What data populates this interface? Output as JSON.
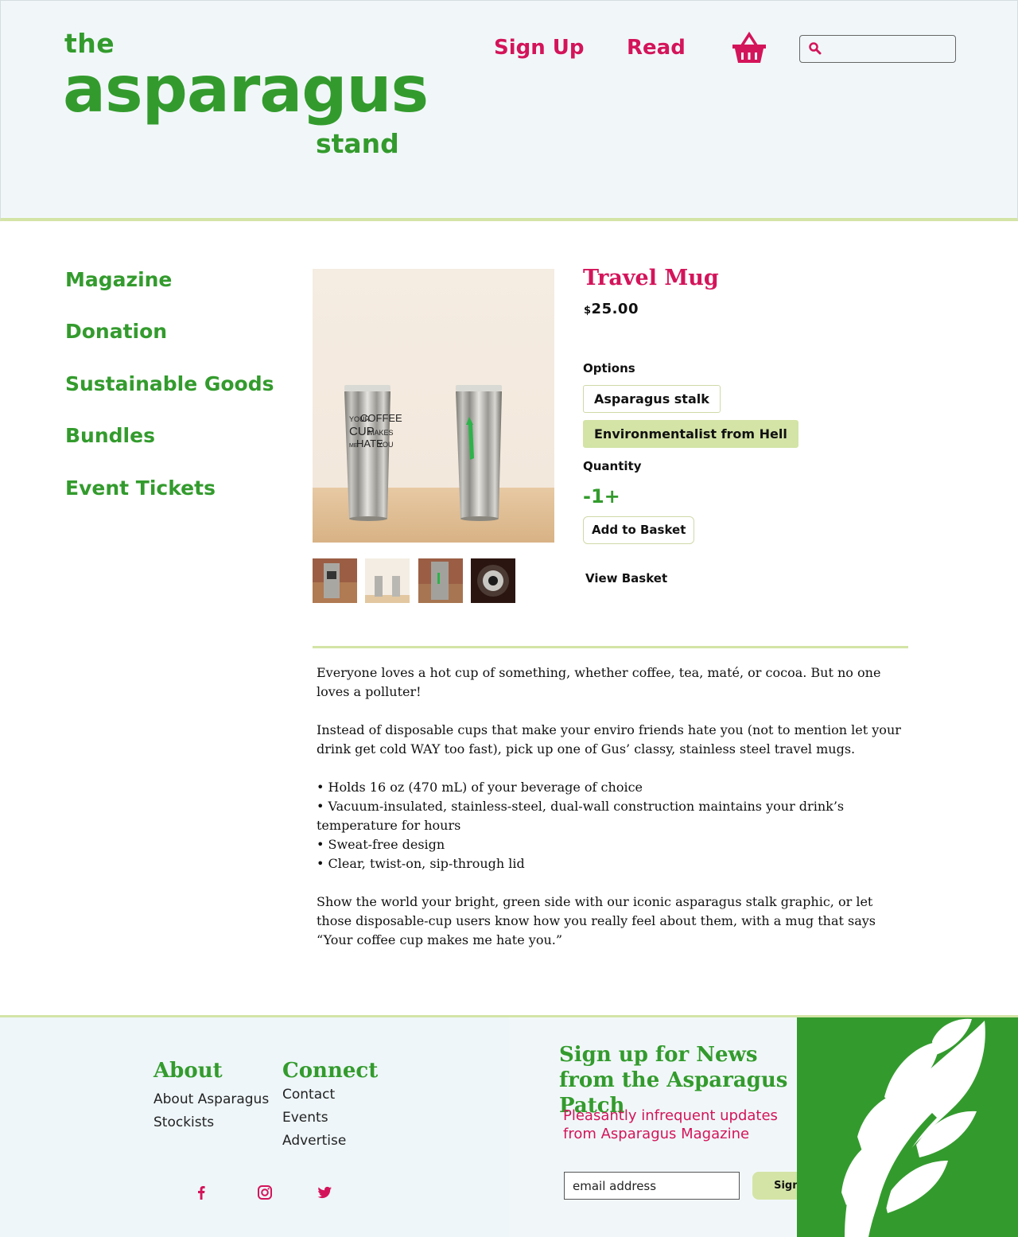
{
  "header": {
    "logo_the": "the",
    "logo_main": "asparagus",
    "logo_stand": "stand",
    "nav": [
      {
        "label": "Sign Up"
      },
      {
        "label": "Read"
      }
    ],
    "basket_icon": "basket-icon",
    "search": {
      "placeholder": "",
      "icon": "search-icon"
    }
  },
  "sidebar": {
    "items": [
      {
        "label": "Magazine"
      },
      {
        "label": "Donation"
      },
      {
        "label": "Sustainable Goods"
      },
      {
        "label": "Bundles"
      },
      {
        "label": "Event Tickets"
      }
    ]
  },
  "product": {
    "title": "Travel Mug",
    "price_currency": "$",
    "price_amount": "25.00",
    "mug_text": [
      "YOUR",
      "COFFEE",
      "CUP",
      "MAKES",
      "ME",
      "HATE",
      "YOU"
    ],
    "options_label": "Options",
    "options": [
      {
        "label": "Asparagus stalk",
        "selected": false
      },
      {
        "label": "Environmentalist from Hell",
        "selected": true
      }
    ],
    "quantity_label": "Quantity",
    "quantity_control": "-1+",
    "add_to_basket": "Add to Basket",
    "view_basket": "View Basket",
    "description": {
      "p1": "Everyone loves a hot cup of something, whether coffee, tea, maté, or cocoa. But no one loves a polluter!",
      "p2": "Instead of disposable cups that make your enviro friends hate you (not to mention let your drink get cold WAY too fast), pick up one of Gus’ classy, stainless steel travel mugs.",
      "bullets": [
        "• Holds 16 oz (470 mL) of your beverage of choice",
        "• Vacuum-insulated, stainless-steel, dual-wall construction maintains your drink’s temperature for hours",
        "• Sweat-free design",
        "• Clear, twist-on, sip-through lid"
      ],
      "p3": "Show the world your bright, green side with our iconic asparagus stalk graphic, or let those disposable-cup users know how you really feel about them, with a mug that says “Your coffee cup makes me hate you.”"
    }
  },
  "footer": {
    "about": {
      "heading": "About",
      "links": [
        "About Asparagus",
        "Stockists"
      ]
    },
    "connect": {
      "heading": "Connect",
      "links": [
        "Contact",
        "Events",
        "Advertise"
      ]
    },
    "social": [
      "facebook-icon",
      "instagram-icon",
      "twitter-icon"
    ],
    "newsletter": {
      "title": "Sign up for News from the Asparagus Patch",
      "subtitle": "Pleasantly infrequent updates from Asparagus Magazine",
      "email_placeholder": "email address",
      "button": "Sign Up"
    }
  },
  "colors": {
    "green": "#339b2d",
    "pink": "#d4145a",
    "light_green": "#d3e4a6",
    "header_bg": "#f1f7f9"
  }
}
